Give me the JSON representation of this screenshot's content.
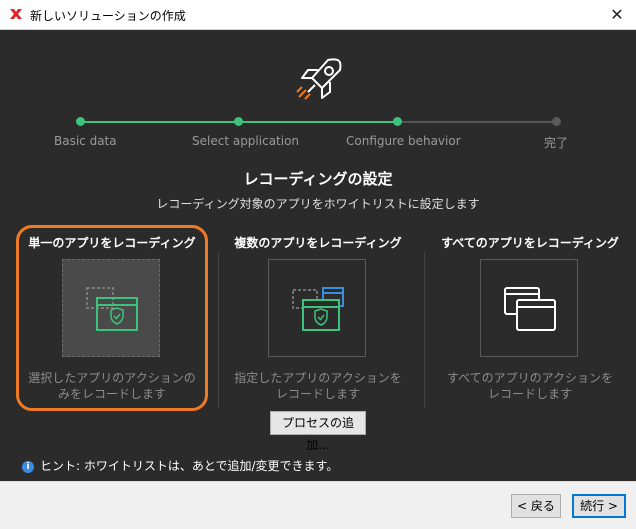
{
  "window": {
    "title": "新しいソリューションの作成",
    "app_icon": "x-logo-icon",
    "close_glyph": "✕"
  },
  "stepper": {
    "steps": [
      {
        "label": "Basic data",
        "state": "done"
      },
      {
        "label": "Select application",
        "state": "done"
      },
      {
        "label": "Configure behavior",
        "state": "current"
      },
      {
        "label": "完了",
        "state": "pending"
      }
    ]
  },
  "header": {
    "title": "レコーディングの設定",
    "subtitle": "レコーディング対象のアプリをホワイトリストに設定します"
  },
  "options": [
    {
      "title": "単一のアプリをレコーディング",
      "description": "選択したアプリのアクションのみをレコードします",
      "selected": true
    },
    {
      "title": "複数のアプリをレコーディング",
      "description": "指定したアプリのアクションをレコードします",
      "selected": false
    },
    {
      "title": "すべてのアプリをレコーディング",
      "description": "すべてのアプリのアクションをレコードします",
      "selected": false
    }
  ],
  "add_process_label": "プロセスの追加...",
  "hint": "ヒント: ホワイトリストは、あとで追加/変更できます。",
  "footer": {
    "back_label": "< 戻る",
    "next_label": "続行 >"
  },
  "colors": {
    "accent_green": "#3cc47c",
    "selection_orange": "#f07a22",
    "app_window_blue": "#3b8de0",
    "brand_red": "#e0242a"
  }
}
